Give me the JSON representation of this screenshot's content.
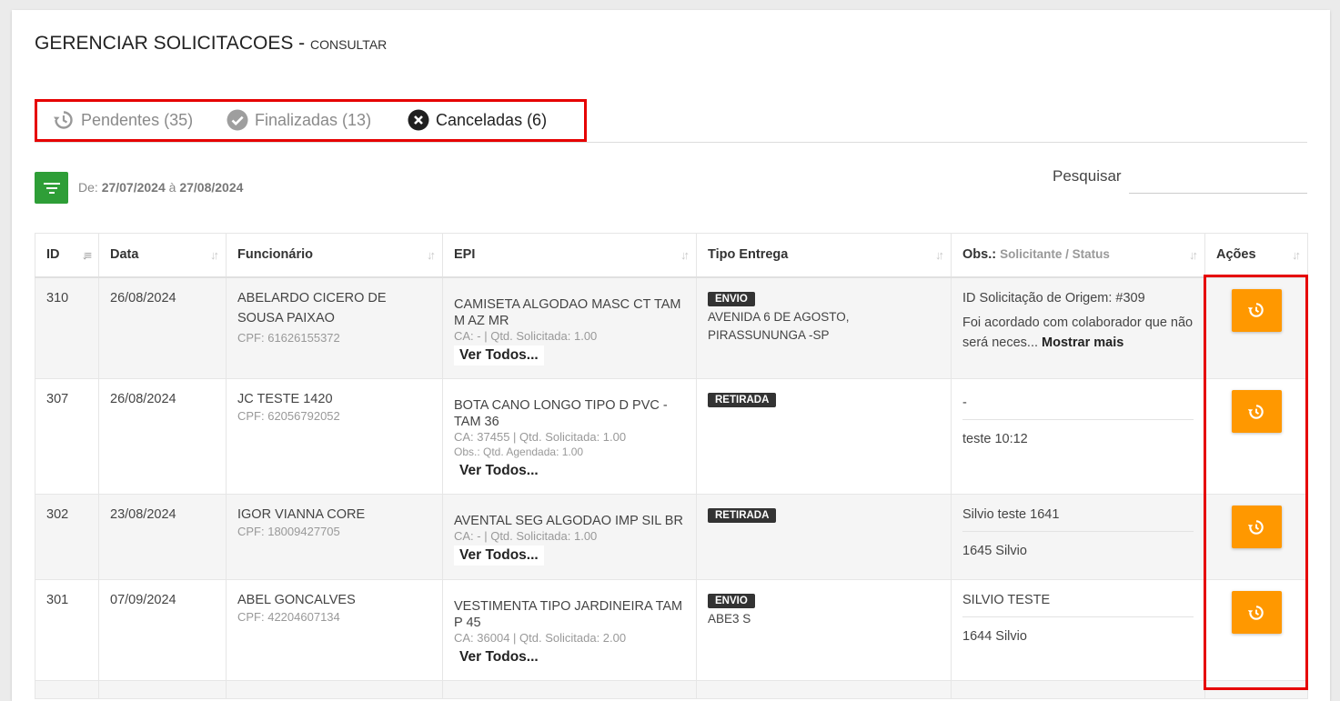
{
  "header": {
    "title": "GERENCIAR SOLICITACOES - ",
    "subtitle": "CONSULTAR"
  },
  "tabs": [
    {
      "label": "Pendentes (35)",
      "icon": "history-icon",
      "active": false
    },
    {
      "label": "Finalizadas (13)",
      "icon": "check-circle-icon",
      "active": false
    },
    {
      "label": "Canceladas (6)",
      "icon": "close-circle-icon",
      "active": true
    }
  ],
  "filter": {
    "icon": "filter-icon",
    "prefix": "De:",
    "from": "27/07/2024",
    "sep": "à",
    "to": "27/08/2024"
  },
  "search": {
    "label": "Pesquisar",
    "value": ""
  },
  "table": {
    "headers": {
      "id": "ID",
      "data": "Data",
      "funcionario": "Funcionário",
      "epi": "EPI",
      "tipo": "Tipo Entrega",
      "obs": "Obs.:",
      "obs_sub": "Solicitante / Status",
      "acoes": "Ações"
    },
    "rows": [
      {
        "id": "310",
        "data": "26/08/2024",
        "nome": "ABELARDO CICERO DE SOUSA PAIXAO",
        "cpf": "CPF: 61626155372",
        "epi": "CAMISETA ALGODAO MASC CT TAM M AZ MR",
        "ca": "CA: - | Qtd. Solicitada: 1.00",
        "ag": "",
        "ver": "Ver Todos...",
        "tipo": "ENVIO",
        "endereco": "AVENIDA 6 DE AGOSTO, PIRASSUNUNGA -SP",
        "obs1": "ID Solicitação de Origem: #309",
        "obs2": "Foi acordado com colaborador que não será neces...",
        "mais": "Mostrar mais"
      },
      {
        "id": "307",
        "data": "26/08/2024",
        "nome": "JC TESTE 1420",
        "cpf": "CPF: 62056792052",
        "epi": "BOTA CANO LONGO TIPO D PVC - TAM 36",
        "ca": "CA: 37455 | Qtd. Solicitada: 1.00",
        "ag": "Obs.: Qtd. Agendada: 1.00",
        "ver": "Ver Todos...",
        "tipo": "RETIRADA",
        "endereco": "",
        "obs1": "-",
        "obs2": "teste 10:12",
        "mais": ""
      },
      {
        "id": "302",
        "data": "23/08/2024",
        "nome": "IGOR VIANNA CORE",
        "cpf": "CPF: 18009427705",
        "epi": "AVENTAL SEG ALGODAO IMP SIL BR",
        "ca": "CA: - | Qtd. Solicitada: 1.00",
        "ag": "",
        "ver": "Ver Todos...",
        "tipo": "RETIRADA",
        "endereco": "",
        "obs1": "Silvio teste 1641",
        "obs2": "1645 Silvio",
        "mais": ""
      },
      {
        "id": "301",
        "data": "07/09/2024",
        "nome": "ABEL GONCALVES",
        "cpf": "CPF: 42204607134",
        "epi": "VESTIMENTA TIPO JARDINEIRA TAM P 45",
        "ca": "CA: 36004 | Qtd. Solicitada: 2.00",
        "ag": "",
        "ver": "Ver Todos...",
        "tipo": "ENVIO",
        "endereco": "ABE3 S",
        "obs1": "SILVIO TESTE",
        "obs2": "1644 Silvio",
        "mais": ""
      }
    ],
    "action_icon": "restore-icon"
  },
  "colors": {
    "accent_orange": "#ff9800",
    "filter_green": "#2e9e37",
    "highlight_red": "#e60000"
  }
}
